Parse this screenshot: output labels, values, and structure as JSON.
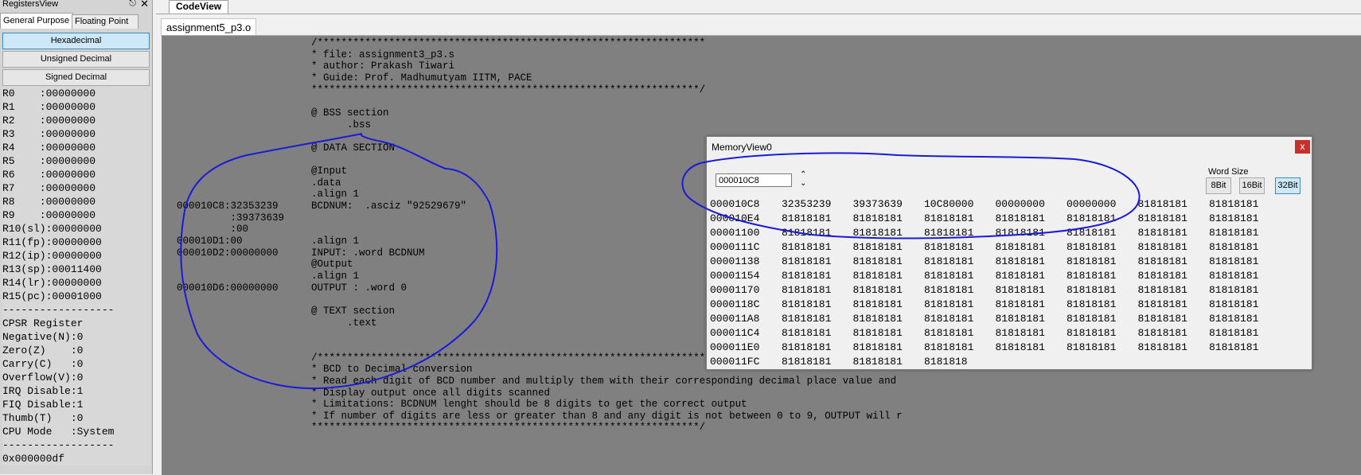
{
  "registers_view": {
    "title": "RegistersView",
    "pin_icon": "pin-icon",
    "close_label": "✕",
    "tabs": [
      "General Purpose",
      "Floating Point"
    ],
    "format_buttons": [
      "Hexadecimal",
      "Unsigned Decimal",
      "Signed Decimal"
    ],
    "lines": [
      "R0    :00000000",
      "R1    :00000000",
      "R2    :00000000",
      "R3    :00000000",
      "R4    :00000000",
      "R5    :00000000",
      "R6    :00000000",
      "R7    :00000000",
      "R8    :00000000",
      "R9    :00000000",
      "R10(sl):00000000",
      "R11(fp):00000000",
      "R12(ip):00000000",
      "R13(sp):00011400",
      "R14(lr):00000000",
      "R15(pc):00001000",
      "------------------",
      "CPSR Register",
      "Negative(N):0",
      "Zero(Z)    :0",
      "Carry(C)   :0",
      "Overflow(V):0",
      "IRQ Disable:1",
      "FIQ Disable:1",
      "Thumb(T)   :0",
      "CPU Mode   :System",
      "------------------",
      "0x000000df"
    ]
  },
  "code_view": {
    "tab_label": "CodeView",
    "file_tab": "assignment5_p3.o",
    "lines": [
      {
        "addr": "",
        "text": "/*****************************************************************"
      },
      {
        "addr": "",
        "text": "* file: assignment3_p3.s"
      },
      {
        "addr": "",
        "text": "* author: Prakash Tiwari"
      },
      {
        "addr": "",
        "text": "* Guide: Prof. Madhumutyam IITM, PACE"
      },
      {
        "addr": "",
        "text": "*****************************************************************/"
      },
      {
        "addr": "",
        "text": ""
      },
      {
        "addr": "",
        "text": "@ BSS section"
      },
      {
        "addr": "",
        "text": "      .bss"
      },
      {
        "addr": "",
        "text": ""
      },
      {
        "addr": "",
        "text": "@ DATA SECTION"
      },
      {
        "addr": "",
        "text": ""
      },
      {
        "addr": "",
        "text": "@Input"
      },
      {
        "addr": "",
        "text": ".data"
      },
      {
        "addr": "",
        "text": ".align 1"
      },
      {
        "addr": "000010C8:32353239",
        "text": "BCDNUM:  .asciz \"92529679\""
      },
      {
        "addr": "         :39373639",
        "text": ""
      },
      {
        "addr": "         :00",
        "text": ""
      },
      {
        "addr": "000010D1:00",
        "text": ".align 1"
      },
      {
        "addr": "000010D2:00000000",
        "text": "INPUT: .word BCDNUM"
      },
      {
        "addr": "",
        "text": "@Output"
      },
      {
        "addr": "",
        "text": ".align 1"
      },
      {
        "addr": "000010D6:00000000",
        "text": "OUTPUT : .word 0"
      },
      {
        "addr": "",
        "text": ""
      },
      {
        "addr": "",
        "text": "@ TEXT section"
      },
      {
        "addr": "",
        "text": "      .text"
      },
      {
        "addr": "",
        "text": ""
      },
      {
        "addr": "",
        "text": ""
      },
      {
        "addr": "",
        "text": "/*****************************************************************"
      },
      {
        "addr": "",
        "text": "* BCD to Decimal conversion"
      },
      {
        "addr": "",
        "text": "* Read each digit of BCD number and multiply them with their corresponding decimal place value and"
      },
      {
        "addr": "",
        "text": "* Display output once all digits scanned"
      },
      {
        "addr": "",
        "text": "* Limitations: BCDNUM lenght should be 8 digits to get the correct output"
      },
      {
        "addr": "",
        "text": "* If number of digits are less or greater than 8 and any digit is not between 0 to 9, OUTPUT will r"
      },
      {
        "addr": "",
        "text": "*****************************************************************/"
      }
    ]
  },
  "memory_view": {
    "title": "MemoryView0",
    "close_label": "x",
    "address_value": "000010C8",
    "word_size_label": "Word Size",
    "word_sizes": [
      "8Bit",
      "16Bit",
      "32Bit"
    ],
    "selected_word_size": "32Bit",
    "rows": [
      {
        "addr": "000010C8",
        "words": [
          "32353239",
          "39373639",
          "10C80000",
          "00000000",
          "00000000",
          "81818181",
          "81818181"
        ]
      },
      {
        "addr": "000010E4",
        "words": [
          "81818181",
          "81818181",
          "81818181",
          "81818181",
          "81818181",
          "81818181",
          "81818181"
        ]
      },
      {
        "addr": "00001100",
        "words": [
          "81818181",
          "81818181",
          "81818181",
          "81818181",
          "81818181",
          "81818181",
          "81818181"
        ]
      },
      {
        "addr": "0000111C",
        "words": [
          "81818181",
          "81818181",
          "81818181",
          "81818181",
          "81818181",
          "81818181",
          "81818181"
        ]
      },
      {
        "addr": "00001138",
        "words": [
          "81818181",
          "81818181",
          "81818181",
          "81818181",
          "81818181",
          "81818181",
          "81818181"
        ]
      },
      {
        "addr": "00001154",
        "words": [
          "81818181",
          "81818181",
          "81818181",
          "81818181",
          "81818181",
          "81818181",
          "81818181"
        ]
      },
      {
        "addr": "00001170",
        "words": [
          "81818181",
          "81818181",
          "81818181",
          "81818181",
          "81818181",
          "81818181",
          "81818181"
        ]
      },
      {
        "addr": "0000118C",
        "words": [
          "81818181",
          "81818181",
          "81818181",
          "81818181",
          "81818181",
          "81818181",
          "81818181"
        ]
      },
      {
        "addr": "000011A8",
        "words": [
          "81818181",
          "81818181",
          "81818181",
          "81818181",
          "81818181",
          "81818181",
          "81818181"
        ]
      },
      {
        "addr": "000011C4",
        "words": [
          "81818181",
          "81818181",
          "81818181",
          "81818181",
          "81818181",
          "81818181",
          "81818181"
        ]
      },
      {
        "addr": "000011E0",
        "words": [
          "81818181",
          "81818181",
          "81818181",
          "81818181",
          "81818181",
          "81818181",
          "81818181"
        ]
      },
      {
        "addr": "000011FC",
        "words": [
          "81818181",
          "81818181",
          "8181818"
        ]
      }
    ]
  },
  "colors": {
    "code_background": "#808080",
    "annotation_ink": "#1a1ad8",
    "selected_button": "#cde8f8",
    "close_button": "#c9302c"
  }
}
